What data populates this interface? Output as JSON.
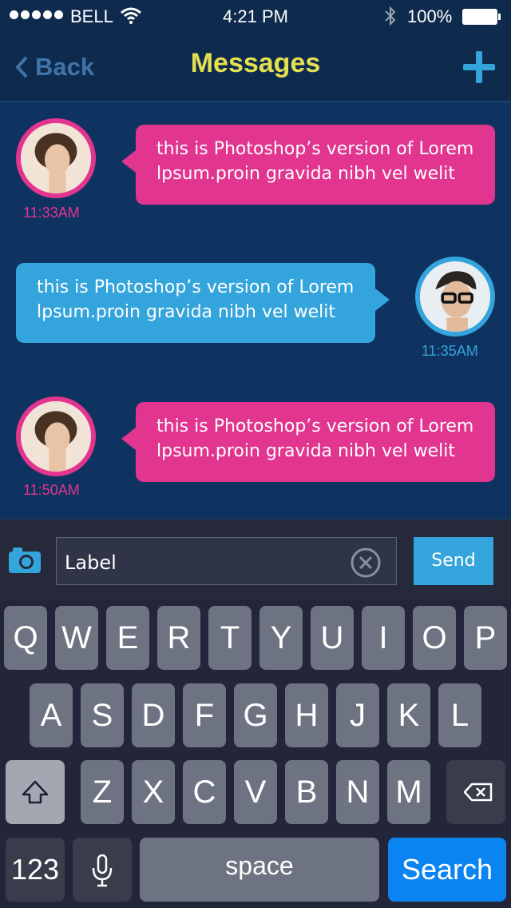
{
  "status_bar": {
    "carrier": "BELL",
    "time": "4:21 PM",
    "battery": "100%"
  },
  "nav": {
    "back_label": "Back",
    "title": "Messages"
  },
  "messages": [
    {
      "side": "left",
      "color": "pink",
      "line1": "this is Photoshop’s version of Lorem",
      "line2": "lpsum.proin gravida nibh vel welit",
      "time": "11:33AM"
    },
    {
      "side": "right",
      "color": "blue",
      "line1": "this is Photoshop’s version of Lorem",
      "line2": "lpsum.proin gravida nibh vel welit",
      "time": "11:35AM"
    },
    {
      "side": "left",
      "color": "pink",
      "line1": "this is Photoshop’s version of Lorem",
      "line2": "lpsum.proin gravida nibh vel welit",
      "time": "11:50AM"
    }
  ],
  "compose": {
    "input_value": "Label",
    "send_label": "Send"
  },
  "keyboard": {
    "row1": [
      "Q",
      "W",
      "E",
      "R",
      "T",
      "Y",
      "U",
      "I",
      "O",
      "P"
    ],
    "row2": [
      "A",
      "S",
      "D",
      "F",
      "G",
      "H",
      "J",
      "K",
      "L"
    ],
    "row3": [
      "Z",
      "X",
      "C",
      "V",
      "B",
      "N",
      "M"
    ],
    "numbers_label": "123",
    "space_label": "space",
    "search_label": "Search"
  },
  "colors": {
    "background": "#0f3360",
    "nav_bar": "#0e2b4d",
    "title": "#e3e052",
    "pink": "#e1358f",
    "blue": "#34a4dc",
    "keyboard": "#23263a",
    "search_key": "#0a84f0"
  },
  "icons": [
    "wifi-icon",
    "bluetooth-icon",
    "battery-icon",
    "chevron-left-icon",
    "plus-icon",
    "camera-icon",
    "clear-icon",
    "shift-icon",
    "backspace-icon",
    "microphone-icon"
  ]
}
